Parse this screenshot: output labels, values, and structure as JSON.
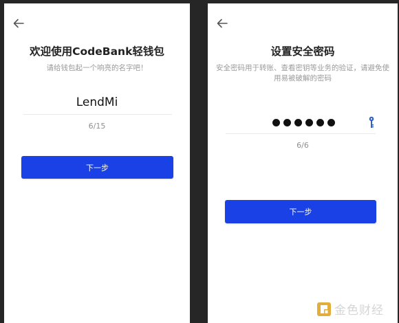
{
  "left": {
    "title": "欢迎使用CodeBank轻钱包",
    "subtitle": "请给钱包起一个响亮的名字吧！",
    "name_value": "LendMi",
    "counter": "6/15",
    "next_label": "下一步"
  },
  "right": {
    "title": "设置安全密码",
    "subtitle": "安全密码用于转账、查看密钥等业务的验证，请避免使用易被破解的密码",
    "password_dots": 6,
    "counter": "6/6",
    "next_label": "下一步"
  },
  "watermark": {
    "text": "金色财经",
    "logo_icon": "jinse-logo-icon"
  },
  "colors": {
    "accent": "#1a41e6",
    "background": "#262626",
    "watermark": "#e2ad3b"
  }
}
